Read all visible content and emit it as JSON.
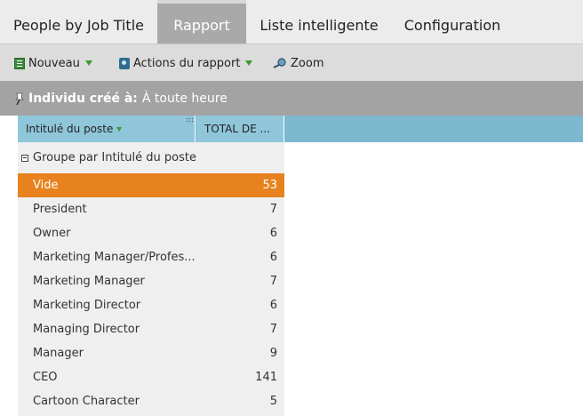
{
  "tabs": [
    {
      "label": "People by Job Title",
      "active": false
    },
    {
      "label": "Rapport",
      "active": true
    },
    {
      "label": "Liste intelligente",
      "active": false
    },
    {
      "label": "Configuration",
      "active": false
    }
  ],
  "toolbar": {
    "new_label": "Nouveau",
    "actions_label": "Actions du rapport",
    "zoom_label": "Zoom"
  },
  "filter": {
    "key": "Individu créé à:",
    "value": "À toute heure"
  },
  "grid": {
    "columns": [
      "Intitulé du poste",
      "TOTAL DE ..."
    ],
    "group_label": "Groupe par Intitulé du poste",
    "rows": [
      {
        "name": "Vide",
        "value": "53",
        "selected": true
      },
      {
        "name": "President",
        "value": "7"
      },
      {
        "name": "Owner",
        "value": "6"
      },
      {
        "name": "Marketing Manager/Profes...",
        "value": "6"
      },
      {
        "name": "Marketing Manager",
        "value": "7"
      },
      {
        "name": "Marketing Director",
        "value": "6"
      },
      {
        "name": "Managing Director",
        "value": "7"
      },
      {
        "name": "Manager",
        "value": "9"
      },
      {
        "name": "CEO",
        "value": "141"
      },
      {
        "name": "Cartoon Character",
        "value": "5"
      }
    ]
  },
  "colors": {
    "selected_row": "#e8821e",
    "header_blue": "#7cb9cf",
    "caret_green": "#3c9a2e"
  }
}
